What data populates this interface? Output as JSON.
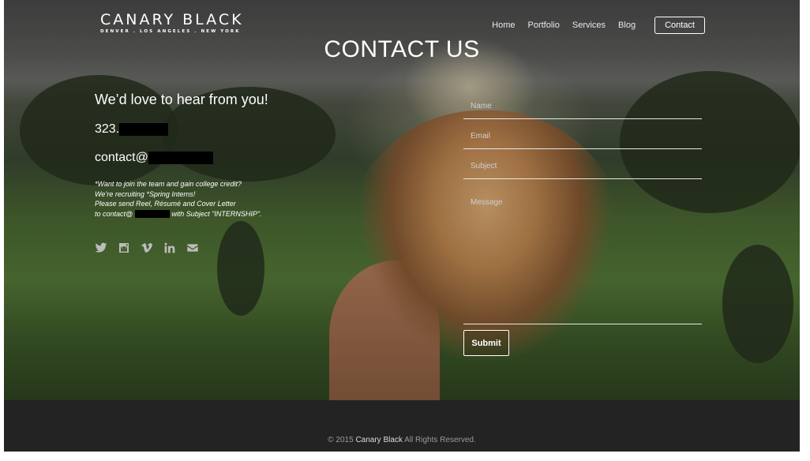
{
  "header": {
    "logo_main": "CANARY BLACK",
    "logo_sub": "DENVER . LOS ANGELES . NEW YORK",
    "nav": [
      "Home",
      "Portfolio",
      "Services",
      "Blog"
    ],
    "contact_button": "Contact"
  },
  "page_title": "CONTACT US",
  "contact_info": {
    "lead": "We’d love to hear from you!",
    "phone_prefix": "323.",
    "email_prefix": "contact@",
    "note_lines": [
      "*Want to join the team and gain college credit?",
      "We’re recruiting *Spring Interns!",
      "Please send Reel, Résumé and Cover Letter",
      "to contact@",
      "with Subject \"INTERNSHIP\"."
    ]
  },
  "social_icons": [
    "twitter-icon",
    "instagram-icon",
    "vimeo-icon",
    "linkedin-icon",
    "mail-icon"
  ],
  "form": {
    "name_placeholder": "Name",
    "email_placeholder": "Email",
    "subject_placeholder": "Subject",
    "message_placeholder": "Message",
    "submit_label": "Submit"
  },
  "footer": {
    "prefix": "© 2015",
    "brand": "Canary Black",
    "suffix": "All Rights Reserved."
  },
  "colors": {
    "footer_bg": "#232323",
    "text": "#ffffff",
    "muted": "#9a9a9a"
  }
}
